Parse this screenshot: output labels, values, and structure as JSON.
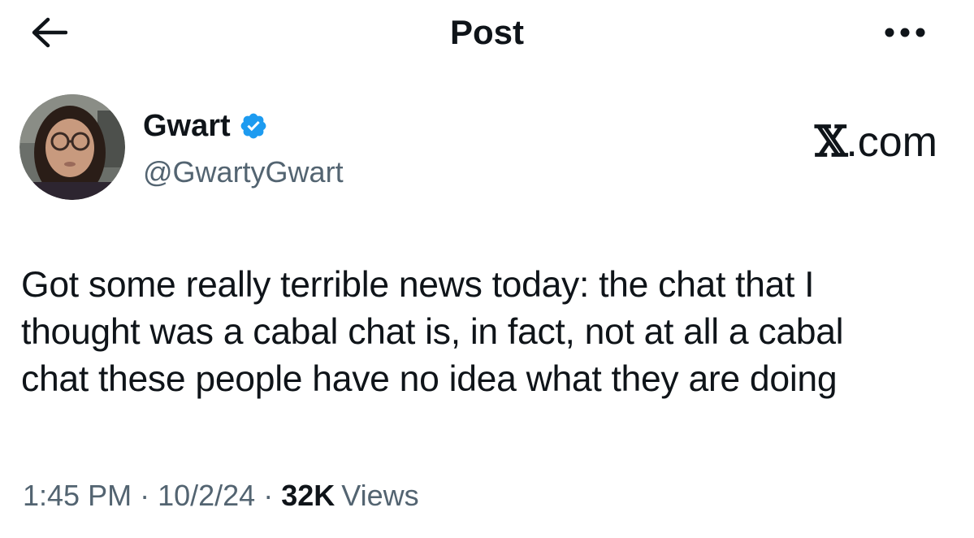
{
  "header": {
    "title": "Post",
    "back_icon": "arrow-left-icon",
    "more_icon": "more-horizontal-icon"
  },
  "author": {
    "name": "Gwart",
    "handle": "@GwartyGwart",
    "verified_icon": "verified-badge-icon",
    "verified_color": "#1d9bf0"
  },
  "watermark": {
    "mark": "𝕏",
    "suffix": ".com"
  },
  "post": {
    "text": "Got some really terrible news today: the chat that I\nthought was a cabal chat is, in fact, not at all a cabal\nchat these people have no idea what they are doing"
  },
  "meta": {
    "time": "1:45 PM",
    "separator": "·",
    "date": "10/2/24",
    "views_count": "32K",
    "views_label": "Views"
  },
  "colors": {
    "text_primary": "#0f1419",
    "text_secondary": "#536471",
    "accent": "#1d9bf0"
  }
}
